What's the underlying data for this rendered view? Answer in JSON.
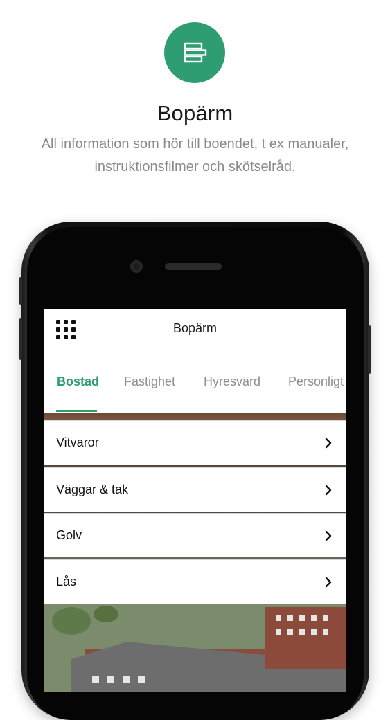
{
  "hero": {
    "icon": "list-stack-icon",
    "title": "Bopärm",
    "description": "All information som hör till boendet, t ex manualer, instruktionsfilmer och skötselråd."
  },
  "app": {
    "title": "Bopärm",
    "menu_icon": "grid-menu-icon",
    "tabs": [
      {
        "label": "Bostad",
        "active": true
      },
      {
        "label": "Fastighet",
        "active": false
      },
      {
        "label": "Hyresvärd",
        "active": false
      },
      {
        "label": "Personligt",
        "active": false
      }
    ],
    "items": [
      {
        "label": "Vitvaror",
        "icon": "chevron-right-icon"
      },
      {
        "label": "Väggar & tak",
        "icon": "chevron-right-icon"
      },
      {
        "label": "Golv",
        "icon": "chevron-right-icon"
      },
      {
        "label": "Lås",
        "icon": "chevron-right-icon"
      }
    ]
  },
  "colors": {
    "accent": "#2e9e72",
    "text": "#1a1a1a",
    "muted": "#8a8a8a"
  }
}
